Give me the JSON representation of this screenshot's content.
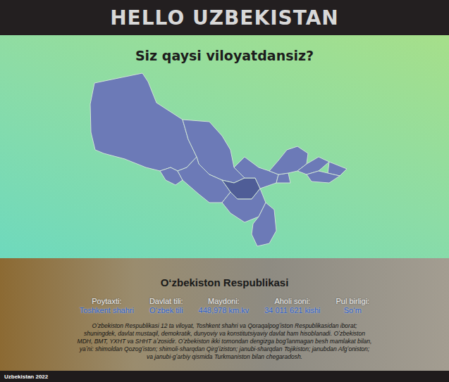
{
  "header": {
    "title": "HELLO UZBEKISTAN"
  },
  "map": {
    "title": "Siz qaysi viloyatdansiz?",
    "regions": [
      {
        "selected": false
      },
      {
        "selected": false
      },
      {
        "selected": false
      },
      {
        "selected": false
      },
      {
        "selected": true
      },
      {
        "selected": false
      },
      {
        "selected": false
      },
      {
        "selected": false
      },
      {
        "selected": false
      },
      {
        "selected": false
      },
      {
        "selected": false
      },
      {
        "selected": false
      },
      {
        "selected": false
      }
    ]
  },
  "info": {
    "title": "Oʻzbekiston Respublikasi",
    "facts": [
      {
        "label": "Poytaxti:",
        "value": "Toshkent shahri"
      },
      {
        "label": "Davlat tili:",
        "value": "Oʻzbek tili"
      },
      {
        "label": "Maydoni:",
        "value": "448,978 km.kv"
      },
      {
        "label": "Aholi soni:",
        "value": "34 011 621 kishi"
      },
      {
        "label": "Pul birligi:",
        "value": "Soʻm"
      }
    ],
    "description": "Oʻzbekiston Respublikasi 12 ta viloyat, Toshkent shahri va Qoraqalpogʻiston Respublikasidan iborat; shuningdek, davlat mustaqil, demokratik, dunyoviy va konstitutsiyaviy davlat ham hisoblanadi. Oʻzbekiston MDH, BMT, YXHT va SHHT aʼzosidir. Oʻzbekiston ikki tomondan dengizga bogʻlanmagan besh mamlakat bilan, yaʼni: shimoldan Qozogʻiston; shimoli-sharqdan Qirgʻiziston; janubi-sharqdan Tojikiston; janubdan Afgʻoniston; va janubi-gʻarbiy qismida Turkmaniston bilan chegaradosh."
  },
  "footer": {
    "text": "Uzbekistan 2022"
  }
}
